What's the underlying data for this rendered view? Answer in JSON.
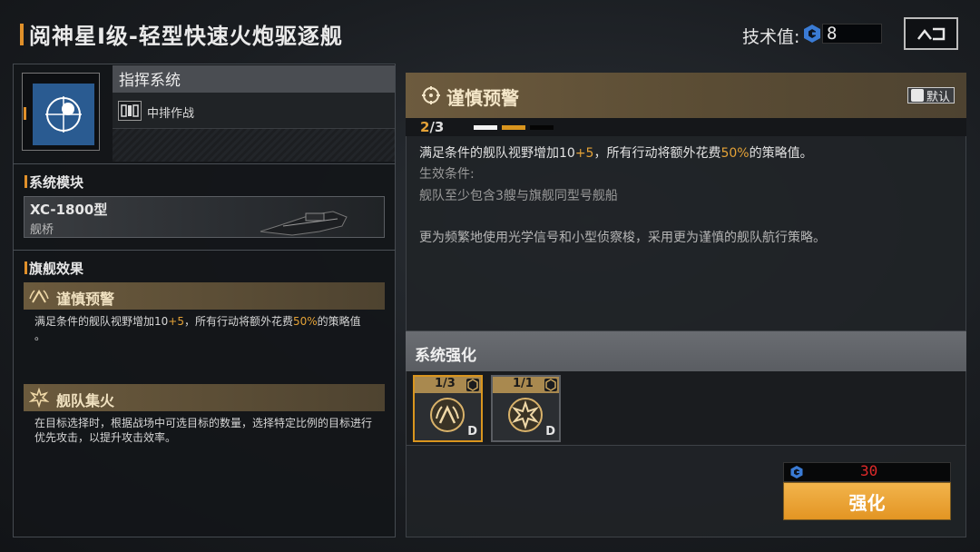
{
  "header": {
    "title": "阅神星I级-轻型快速火炮驱逐舰",
    "tech_label": "技术值:",
    "tech_value": "8",
    "back_icon": "back-arrow-icon"
  },
  "command": {
    "title": "指挥系统",
    "sub_label": "中排作战",
    "icon": "targeting-crosshair-icon"
  },
  "module": {
    "section_title": "系统模块",
    "name": "XC-1800型",
    "type": "舰桥"
  },
  "flagship": {
    "section_title": "旗舰效果",
    "effects": [
      {
        "title": "谨慎预警",
        "desc_a": "满足条件的舰队视野增加10",
        "desc_b": "+5",
        "desc_c": "，所有行动将额外花费",
        "desc_d": "50%",
        "desc_e": "的策略值",
        "desc_f": "。"
      },
      {
        "title": "舰队集火",
        "desc": "在目标选择时，根据战场中可选目标的数量，选择特定比例的目标进行优先攻击，以提升攻击效率。"
      }
    ]
  },
  "skill": {
    "title": "谨慎预警",
    "default_label": "默认",
    "level_current": "2",
    "level_max": "/3",
    "level_segments": [
      "filled-white",
      "filled-gold",
      "empty"
    ],
    "desc_a": "满足条件的舰队视野增加10",
    "desc_b": "+5",
    "desc_c": "，所有行动将额外花费",
    "desc_d": "50%",
    "desc_e": "的策略值。",
    "cond_label": "生效条件:",
    "cond": "舰队至少包含3艘与旗舰同型号舰船",
    "flavor": "更为频繁地使用光学信号和小型侦察梭，采用更为谨慎的舰队航行策略。"
  },
  "enhance": {
    "title": "系统强化",
    "slots": [
      {
        "level": "1/3",
        "rank": "D",
        "icon": "caution-signal-icon",
        "selected": true
      },
      {
        "level": "1/1",
        "rank": "D",
        "icon": "focus-fire-icon",
        "selected": false
      }
    ],
    "cost": "30",
    "button_label": "强化"
  },
  "colors": {
    "accent_orange": "#e0902a",
    "highlight": "#e4a237",
    "cost_red": "#e02a2a",
    "button_gold": "#f2b44c"
  }
}
